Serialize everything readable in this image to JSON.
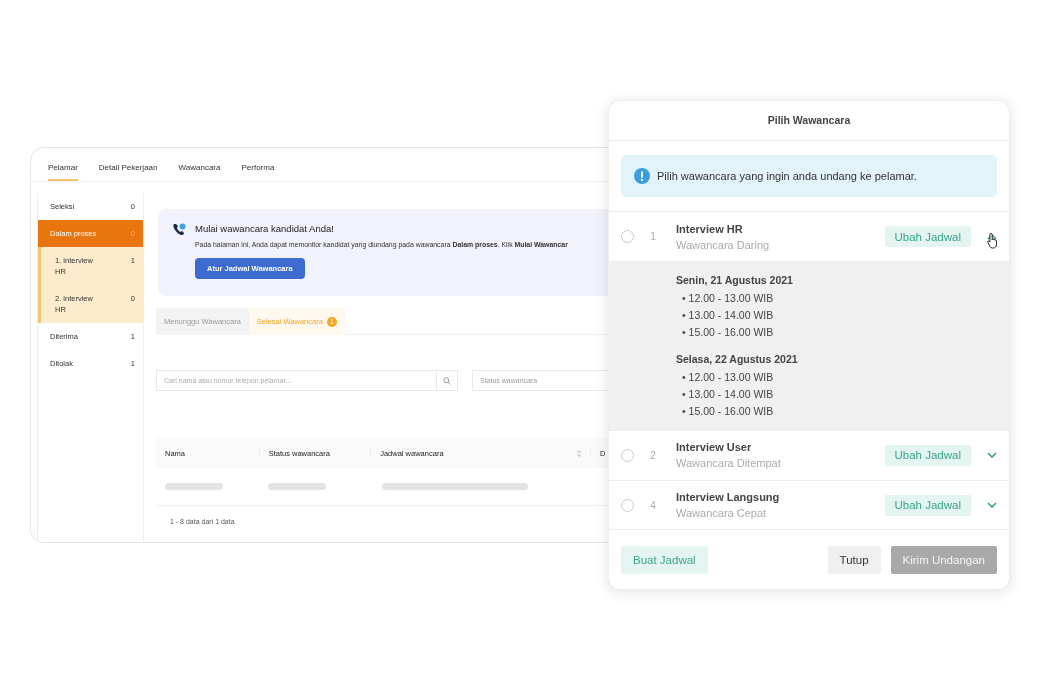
{
  "main_tabs": [
    {
      "label": "Pelamar",
      "selected": true
    },
    {
      "label": "Detail Pekerjaan",
      "selected": false
    },
    {
      "label": "Wawancara",
      "selected": false
    },
    {
      "label": "Performa",
      "selected": false
    }
  ],
  "sidebar": {
    "items": [
      {
        "label": "Seleksi",
        "count": "0",
        "selected": false
      },
      {
        "label": "Dalam proses",
        "count": "0",
        "selected": true,
        "children": [
          {
            "label": "1. interview HR",
            "count": "1"
          },
          {
            "label": "2. interview HR",
            "count": "0"
          }
        ]
      },
      {
        "label": "Diterima",
        "count": "1",
        "selected": false
      },
      {
        "label": "Ditolak",
        "count": "1",
        "selected": false
      }
    ]
  },
  "banner": {
    "title": "Mulai wawancara kandidat Anda!",
    "text": "Pada halaman ini, Anda dapat memonitor kandidat yang diundang pada wawancara **Dalam proses**. Klik **Mulai Wawancar**",
    "button": "Atur Jadwal Wawancara"
  },
  "sub_tabs": [
    {
      "label": "Menunggu Wawancara",
      "selected": false
    },
    {
      "label": "Selesai Wawancara",
      "selected": true,
      "badge": "1"
    }
  ],
  "search": {
    "placeholder": "Cari nama atau nomor telepon pelamar..."
  },
  "status_filter": {
    "placeholder": "Status wawancara"
  },
  "table": {
    "columns": [
      "Nama",
      "Status wawancara",
      "Jadwal wawancara",
      "D"
    ],
    "footer": "1 - 8 data dari 1 data"
  },
  "modal": {
    "title": "Pilih Wawancara",
    "info": "Pilih wawancara yang ingin anda undang ke pelamar.",
    "interviews": [
      {
        "number": "1",
        "title": "Interview HR",
        "type": "Wawancara Daring",
        "action": "Ubah Jadwal",
        "selected": false,
        "expanded": true,
        "schedule": [
          {
            "date": "Senin, 21 Agustus 2021",
            "times": [
              "• 12.00 - 13.00 WIB",
              "• 13.00 - 14.00 WIB",
              "• 15.00 - 16.00 WIB"
            ]
          },
          {
            "date": "Selasa, 22 Agustus 2021",
            "times": [
              "• 12.00 - 13.00 WIB",
              "• 13.00 - 14.00 WIB",
              "• 15.00 - 16.00 WIB"
            ]
          }
        ]
      },
      {
        "number": "2",
        "title": "Interview User",
        "type": "Wawancara Ditempat",
        "action": "Ubah Jadwal",
        "selected": false,
        "expanded": false
      },
      {
        "number": "4",
        "title": "Interview Langsung",
        "type": "Wawancara Cepat",
        "action": "Ubah Jadwal",
        "selected": false,
        "expanded": false
      }
    ],
    "buttons": [
      {
        "label": "Buat Jadwal",
        "kind": "secondary",
        "disabled": false
      },
      {
        "label": "Tutup",
        "kind": "neutral",
        "disabled": false
      },
      {
        "label": "Kirim Undangan",
        "kind": "primary",
        "disabled": true
      }
    ]
  }
}
